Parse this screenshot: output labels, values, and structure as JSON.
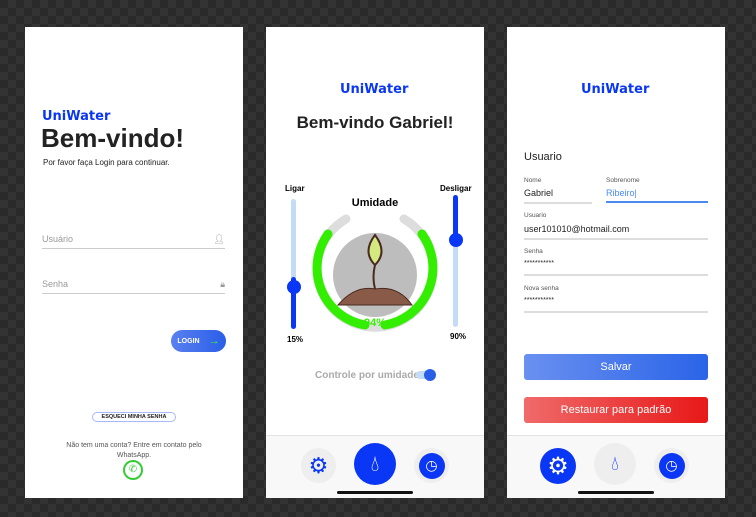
{
  "brand": "UniWater",
  "login": {
    "title": "Bem-vindo!",
    "subtitle": "Por favor faça Login para continuar.",
    "user_placeholder": "Usuário",
    "pass_placeholder": "Senha",
    "login_label": "LOGIN",
    "forgot_label": "ESQUECI MINHA SENHA",
    "contact": "Não tem uma conta? Entre em contato pelo WhatsApp."
  },
  "home": {
    "title": "Bem-vindo Gabriel!",
    "gauge_label": "Umidade",
    "humidity": "94%",
    "humidity_value": 94,
    "on_label": "Ligar",
    "on_value": "15%",
    "on_level": 15,
    "off_label": "Desligar",
    "off_value": "90%",
    "off_level": 90,
    "toggle_label": "Controle por umidade",
    "toggle_on": true
  },
  "profile": {
    "section": "Usuario",
    "name_label": "Nome",
    "name": "Gabriel",
    "surname_label": "Sobrenome",
    "surname": "Ribeiro|",
    "user_label": "Usuario",
    "user": "user101010@hotmail.com",
    "pass_label": "Senha",
    "pass": "***********",
    "newpass_label": "Nova senha",
    "newpass": "***********",
    "save_label": "Salvar",
    "reset_label": "Restaurar para padrão"
  },
  "colors": {
    "accent": "#0a36f5",
    "green": "#33ee00",
    "red": "#e81818"
  }
}
